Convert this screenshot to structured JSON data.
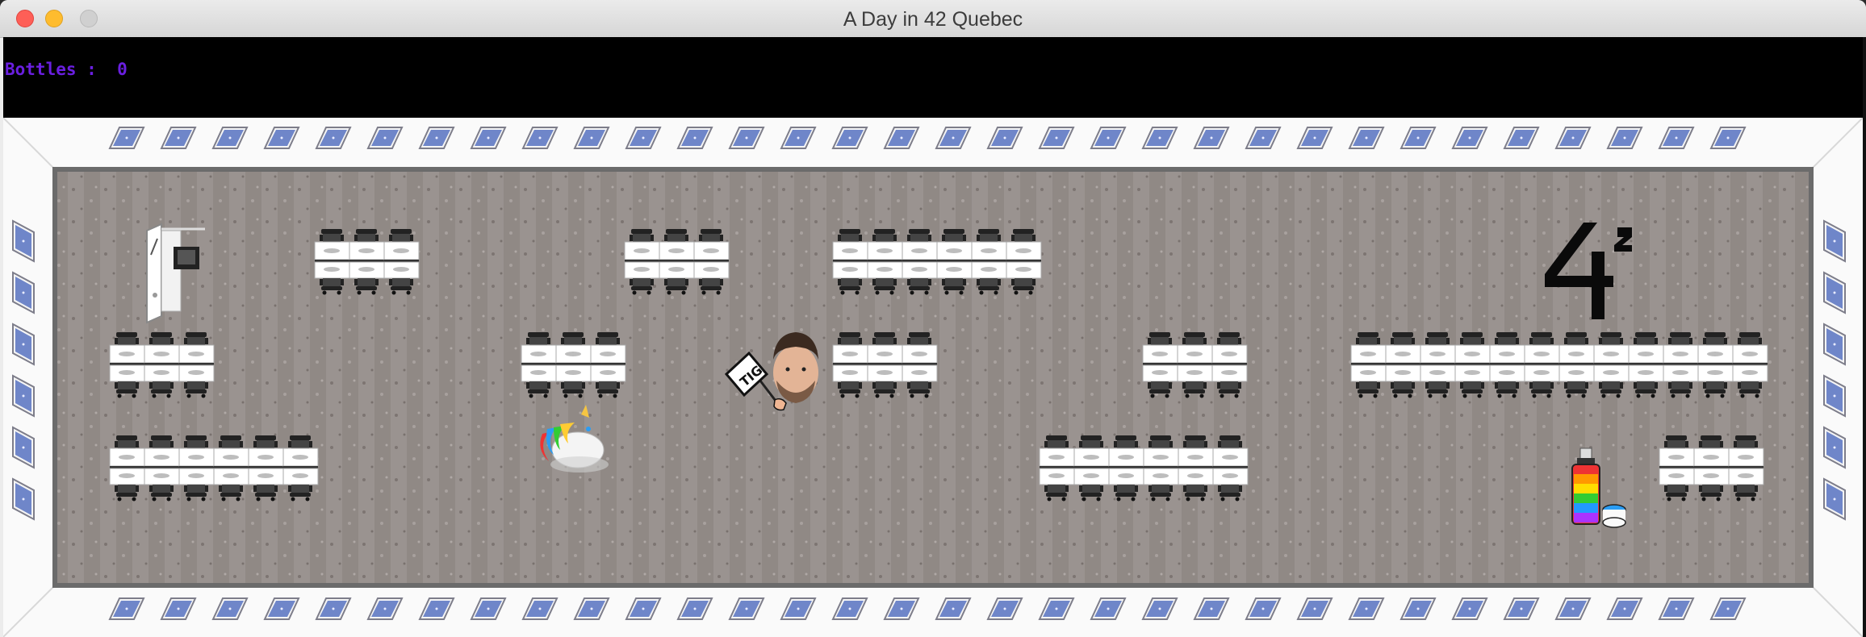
{
  "window": {
    "title": "A Day in 42 Quebec"
  },
  "hud": {
    "label": "Bottles :",
    "value": "0"
  },
  "sprites": {
    "player": "bearded-head-with-tig-sign",
    "tig_sign_text": "TIG",
    "pet": "rainbow-unicorn-icon",
    "pickup": "rainbow-bottle-icon",
    "logo": "42-logo"
  },
  "colors": {
    "hud_background": "#000000",
    "hud_text": "#6a1fe0",
    "floor": "#8f8885",
    "wall": "#fafafa",
    "window_tile": "#6f86c9"
  }
}
